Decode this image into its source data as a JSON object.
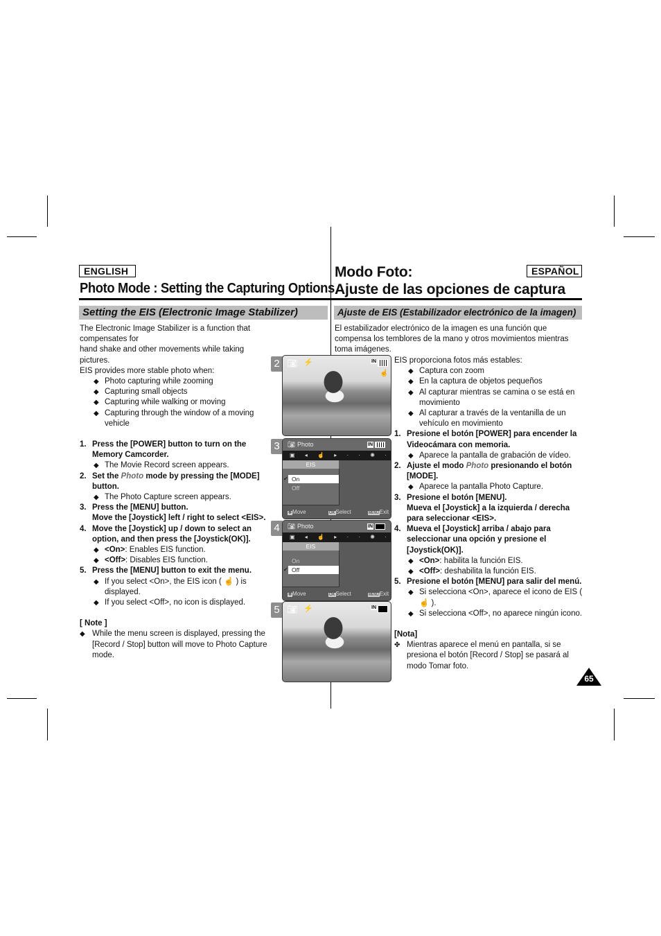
{
  "english": {
    "lang_label": "ENGLISH",
    "title": "Photo Mode : Setting the Capturing Options",
    "subheading": "Setting the EIS (Electronic Image Stabilizer)",
    "intro": [
      "The Electronic Image Stabilizer is a function that compensates for",
      "hand shake and other movements while taking pictures.",
      "EIS provides more stable photo when:"
    ],
    "bullets": [
      "Photo capturing while zooming",
      "Capturing small objects",
      "Capturing while walking or moving",
      "Capturing through the window of a moving vehicle"
    ],
    "steps": [
      {
        "num": "1.",
        "text": "Press the [POWER] button to turn on the Memory Camcorder.",
        "subs": [
          "The Movie Record screen appears."
        ]
      },
      {
        "num": "2.",
        "pre": "Set the ",
        "italic": "Photo",
        "post": " mode by pressing the [MODE] button.",
        "subs": [
          "The Photo Capture screen appears."
        ]
      },
      {
        "num": "3.",
        "text": "Press the [MENU] button.",
        "text2": "Move the [Joystick] left / right to select <EIS>.",
        "subs": []
      },
      {
        "num": "4.",
        "text": "Move the [Joystick] up / down to select an option, and then press the  [Joystick(OK)].",
        "subs_bold": [
          {
            "b": "<On>",
            "t": ": Enables EIS function."
          },
          {
            "b": "<Off>",
            "t": ": Disables EIS function."
          }
        ]
      },
      {
        "num": "5.",
        "text": "Press the [MENU] button to exit the menu.",
        "subs": [
          "If you select <On>, the EIS icon ( ☝ ) is displayed.",
          "If you select <Off>, no icon is displayed."
        ]
      }
    ],
    "note_title": "[ Note ]",
    "note": "While the menu screen is displayed, pressing the [Record / Stop] button will move to Photo Capture mode."
  },
  "spanish": {
    "lang_label": "ESPAÑOL",
    "title_line1": "Modo Foto:",
    "title_line2": "Ajuste de las opciones de captura",
    "subheading": "Ajuste de EIS (Estabilizador electrónico de la imagen)",
    "intro": [
      "El estabilizador electrónico de la imagen es una función que",
      "compensa los temblores de la mano y otros movimientos mientras",
      "toma imágenes."
    ],
    "intro2": "EIS proporciona fotos más estables:",
    "bullets": [
      "Captura con zoom",
      "En la captura de objetos pequeños",
      "Al capturar mientras se camina o se está en movimiento",
      "Al capturar a través de la ventanilla de un vehículo en movimiento"
    ],
    "steps": [
      {
        "num": "1.",
        "text": "Presione el botón [POWER] para encender la Videocámara con memoria.",
        "subs": [
          "Aparece la pantalla de grabación de vídeo."
        ]
      },
      {
        "num": "2.",
        "pre": "Ajuste el modo ",
        "italic": "Photo",
        "post": " presionando el botón [MODE].",
        "subs": [
          "Aparece la pantalla Photo Capture."
        ]
      },
      {
        "num": "3.",
        "text": "Presione el botón [MENU].",
        "text2": "Mueva el [Joystick] a la izquierda / derecha para seleccionar <EIS>.",
        "subs": []
      },
      {
        "num": "4.",
        "text": "Mueva el [Joystick] arriba / abajo para seleccionar una opción y presione el [Joystick(OK)].",
        "subs_bold": [
          {
            "b": "<On>",
            "t": ": habilita la función EIS."
          },
          {
            "b": "<Off>",
            "t": ": deshabilita la función EIS."
          }
        ]
      },
      {
        "num": "5.",
        "text": "Presione el botón [MENU] para salir del menú.",
        "subs": [
          "Si selecciona <On>, aparece el icono de EIS ( ☝ ).",
          "Si selecciona <Off>, no aparece ningún icono."
        ]
      }
    ],
    "note_title": "[Nota]",
    "note": "Mientras aparece el menú en pantalla, si se presiona el botón [Record / Stop] se pasará al modo Tomar foto."
  },
  "screens": [
    {
      "num": "2",
      "type": "photo",
      "eis_icon": true
    },
    {
      "num": "3",
      "type": "menu",
      "title": "Photo",
      "menu_label": "EIS",
      "options": [
        "On",
        "Off"
      ],
      "selected": "On",
      "footer": {
        "move": "Move",
        "select": "Select",
        "exit": "Exit",
        "ok_key": "OK",
        "menu_key": "MENU"
      }
    },
    {
      "num": "4",
      "type": "menu",
      "title": "Photo",
      "menu_label": "EIS",
      "options": [
        "On",
        "Off"
      ],
      "selected": "Off",
      "footer": {
        "move": "Move",
        "select": "Select",
        "exit": "Exit",
        "ok_key": "OK",
        "menu_key": "MENU"
      }
    },
    {
      "num": "5",
      "type": "photo",
      "eis_icon": false
    }
  ],
  "osd": {
    "memory_badge": "IN"
  },
  "page_number": "65"
}
